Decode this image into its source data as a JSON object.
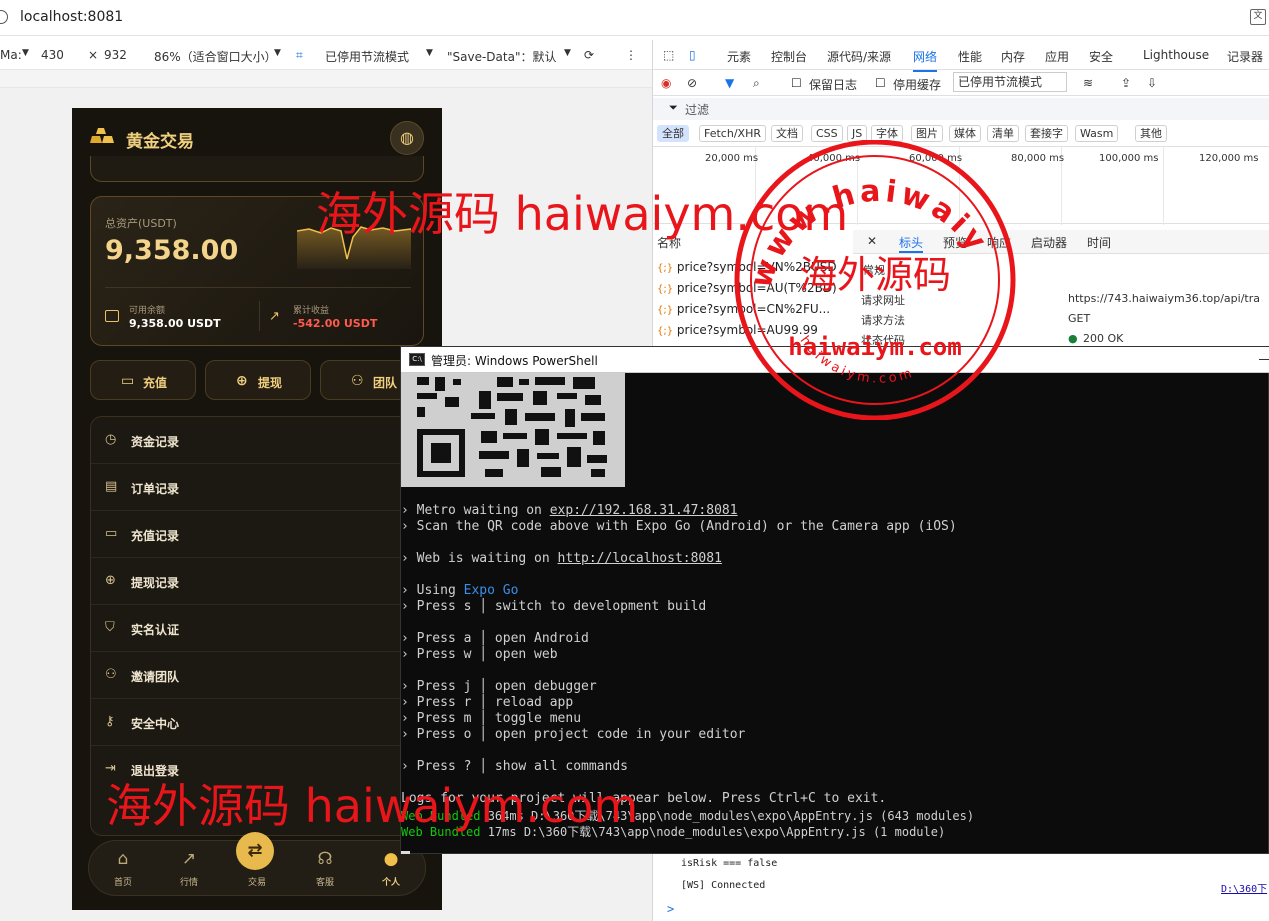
{
  "browser": {
    "url": "localhost:8081"
  },
  "device_toolbar": {
    "device": "Ma:",
    "width": "430",
    "times": "×",
    "height": "932",
    "zoom": "86%（适合窗口大小）",
    "throttle": "已停用节流模式",
    "save_data": "\"Save-Data\"：默认"
  },
  "app": {
    "title": "黄金交易",
    "asset_label": "总资产(USDT)",
    "asset_value": "9,358.00",
    "available_label": "可用余额",
    "available_value": "9,358.00 USDT",
    "pnl_label": "累计收益",
    "pnl_value": "-542.00 USDT",
    "actions": [
      "充值",
      "提现",
      "团队"
    ],
    "menu": [
      "资金记录",
      "订单记录",
      "充值记录",
      "提现记录",
      "实名认证",
      "邀请团队",
      "安全中心",
      "退出登录"
    ],
    "tabs": [
      "首页",
      "行情",
      "交易",
      "客服",
      "个人"
    ]
  },
  "devtools": {
    "tabs": [
      "元素",
      "控制台",
      "源代码/来源",
      "网络",
      "性能",
      "内存",
      "应用",
      "安全",
      "Lighthouse",
      "记录器"
    ],
    "active_tab": "网络",
    "preserve_log": "保留日志",
    "disable_cache": "停用缓存",
    "throttle": "已停用节流模式",
    "filter_placeholder": "过滤",
    "types": [
      "全部",
      "Fetch/XHR",
      "文档",
      "CSS",
      "JS",
      "字体",
      "图片",
      "媒体",
      "清单",
      "套接字",
      "Wasm",
      "其他"
    ],
    "timeline": [
      "20,000 ms",
      "40,000 ms",
      "60,000 ms",
      "80,000 ms",
      "100,000 ms",
      "120,000 ms"
    ],
    "name_header": "名称",
    "requests": [
      "price?symbol=VN%2BUSD",
      "price?symbol=AU(T%2BD)",
      "price?symbol=CN%2FU...",
      "price?symbol=AU99.99"
    ],
    "detail_tabs": [
      "标头",
      "预览",
      "响应",
      "启动器",
      "时间"
    ],
    "general_label": "常规",
    "url_label": "请求网址",
    "url_value": "https://743.haiwaiym36.top/api/tra",
    "method_label": "请求方法",
    "method_value": "GET",
    "status_label": "状态代码",
    "status_value": "200 OK",
    "console_lines": [
      "isRisk === false",
      "[WS] Connected"
    ],
    "console_link": "D:\\360下",
    "prompt": ">"
  },
  "powershell": {
    "title": "管理员: Windows PowerShell",
    "lines": [
      {
        "p": "› ",
        "t": "Metro waiting on ",
        "u": "exp://192.168.31.47:8081"
      },
      {
        "p": "› ",
        "t": "Scan the QR code above with Expo Go (Android) or the Camera app (iOS)"
      },
      {
        "p": "› ",
        "t": "Web is waiting on ",
        "u": "http://localhost:8081"
      },
      {
        "p": "› ",
        "t": "Using ",
        "b": "Expo Go"
      },
      {
        "p": "› ",
        "t": "Press s │ switch to development build"
      },
      {
        "p": "› ",
        "t": "Press a │ open Android"
      },
      {
        "p": "› ",
        "t": "Press w │ open web"
      },
      {
        "p": "› ",
        "t": "Press j │ open debugger"
      },
      {
        "p": "› ",
        "t": "Press r │ reload app"
      },
      {
        "p": "› ",
        "t": "Press m │ toggle menu"
      },
      {
        "p": "› ",
        "t": "Press o │ open project code in your editor"
      },
      {
        "p": "› ",
        "t": "Press ? │ show all commands"
      },
      {
        "p": "",
        "t": "Logs for your project will appear below. Press Ctrl+C to exit."
      },
      {
        "p": "",
        "g": "Web Bundled",
        "t": " 364ms D:\\360下载\\743\\app\\node_modules\\expo\\AppEntry.js (643 modules)"
      },
      {
        "p": "",
        "g": "Web Bundled",
        "t": " 17ms D:\\360下载\\743\\app\\node_modules\\expo\\AppEntry.js (1 module)"
      }
    ]
  },
  "watermark": {
    "text": "海外源码 haiwaiym.com",
    "stamp_top": "www.haiwaiym.com",
    "stamp_center": "海外源码",
    "stamp_mid": "haiwaiym.com",
    "stamp_bottom": "haiwaiym.com",
    "color": "#e8151b"
  }
}
